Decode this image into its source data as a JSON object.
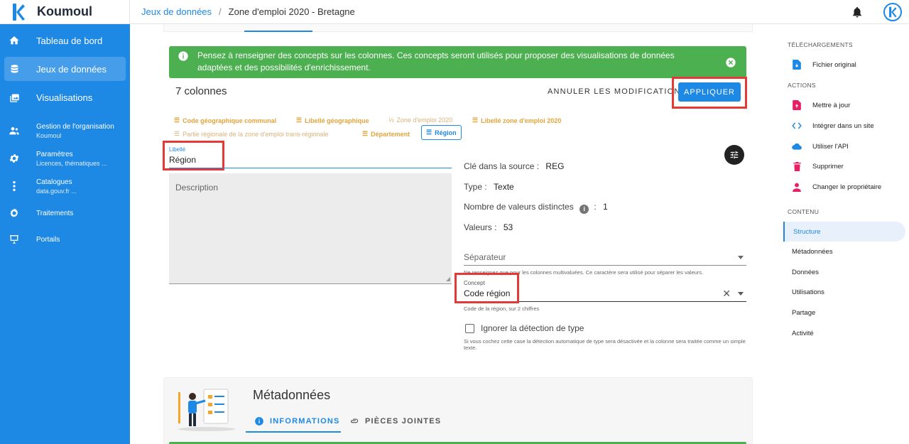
{
  "app": {
    "name": "Koumoul",
    "logo_letter": "K"
  },
  "breadcrumb": {
    "parent": "Jeux de données",
    "separator": "/",
    "current": "Zone d'emploi 2020 - Bretagne"
  },
  "sidebar": {
    "items": [
      {
        "label": "Tableau de bord",
        "icon": "home-icon"
      },
      {
        "label": "Jeux de données",
        "icon": "database-icon",
        "active": true
      },
      {
        "label": "Visualisations",
        "icon": "image-icon"
      },
      {
        "label": "Gestion de l'organisation",
        "sub": "Koumoul",
        "icon": "group-icon"
      },
      {
        "label": "Paramètres",
        "sub": "Licences, thématiques ...",
        "icon": "gear-icon"
      },
      {
        "label": "Catalogues",
        "sub": "data.gouv.fr ...",
        "icon": "dots-icon"
      },
      {
        "label": "Traitements",
        "icon": "cogs-icon"
      },
      {
        "label": "Portails",
        "icon": "presentation-icon"
      }
    ]
  },
  "alert": {
    "text": "Pensez à renseigner des concepts sur les colonnes. Ces concepts seront utilisés pour proposer des visualisations de données adaptées et des possibilités d'enrichissement."
  },
  "schema": {
    "column_count": "7 colonnes",
    "cancel_label": "ANNULER LES MODIFICATIONS",
    "apply_label": "APPLIQUER",
    "chips": [
      {
        "label": "Code géographique communal",
        "icon": "text-icon",
        "style": "bold"
      },
      {
        "label": "Libellé géographique",
        "icon": "text-icon",
        "style": "bold"
      },
      {
        "label": "Zone d'emploi 2020",
        "icon": "number-icon",
        "style": "light"
      },
      {
        "label": "Libellé zone d'emploi 2020",
        "icon": "text-icon",
        "style": "bold"
      },
      {
        "label": "Partie régionale de la zone d'emploi trans-régionale",
        "icon": "text-icon",
        "style": "light"
      },
      {
        "label": "Département",
        "icon": "text-icon",
        "style": "bold"
      },
      {
        "label": "Région",
        "icon": "text-icon",
        "style": "selected"
      }
    ]
  },
  "column": {
    "libelle_label": "Libellé",
    "libelle_value": "Région",
    "description_placeholder": "Description",
    "source_key_label": "Clé dans la source :",
    "source_key_value": "REG",
    "type_label": "Type :",
    "type_value": "Texte",
    "distinct_label": "Nombre de valeurs distinctes",
    "distinct_value": "1",
    "info_glyph": "i",
    "colon": ":",
    "values_label": "Valeurs :",
    "values_value": "53",
    "separator_label": "Séparateur",
    "separator_hint": "Ne renseignez que pour les colonnes multivaluées. Ce caractère sera utilisé pour séparer les valeurs.",
    "concept_label": "Concept",
    "concept_value": "Code région",
    "concept_hint": "Code de la région, sur 2 chiffres",
    "ignore_label": "Ignorer la détection de type",
    "ignore_hint": "Si vous cochez cette case la détection automatique de type sera désactivée et la colonne sera traitée comme un simple texte."
  },
  "metadata": {
    "title": "Métadonnées",
    "tab_info": "INFORMATIONS",
    "tab_attachments": "PIÈCES JOINTES"
  },
  "rightpanel": {
    "downloads_title": "TÉLÉCHARGEMENTS",
    "downloads": [
      {
        "label": "Fichier original",
        "icon": "file-download-icon",
        "color": "#1e88e5"
      }
    ],
    "actions_title": "ACTIONS",
    "actions": [
      {
        "label": "Mettre à jour",
        "icon": "file-upload-icon",
        "color": "#e91e63"
      },
      {
        "label": "Intégrer dans un site",
        "icon": "code-icon",
        "color": "#1e88e5"
      },
      {
        "label": "Utiliser l'API",
        "icon": "cloud-icon",
        "color": "#1e88e5"
      },
      {
        "label": "Supprimer",
        "icon": "trash-icon",
        "color": "#e91e63"
      },
      {
        "label": "Changer le propriétaire",
        "icon": "person-icon",
        "color": "#e91e63"
      }
    ],
    "content_title": "CONTENU",
    "content": [
      {
        "label": "Structure",
        "active": true
      },
      {
        "label": "Métadonnées"
      },
      {
        "label": "Données"
      },
      {
        "label": "Utilisations"
      },
      {
        "label": "Partage"
      },
      {
        "label": "Activité"
      }
    ]
  },
  "colors": {
    "primary": "#1e88e5",
    "success": "#4caf50",
    "highlight": "#e53935",
    "concept_chip": "#e3a43a"
  }
}
